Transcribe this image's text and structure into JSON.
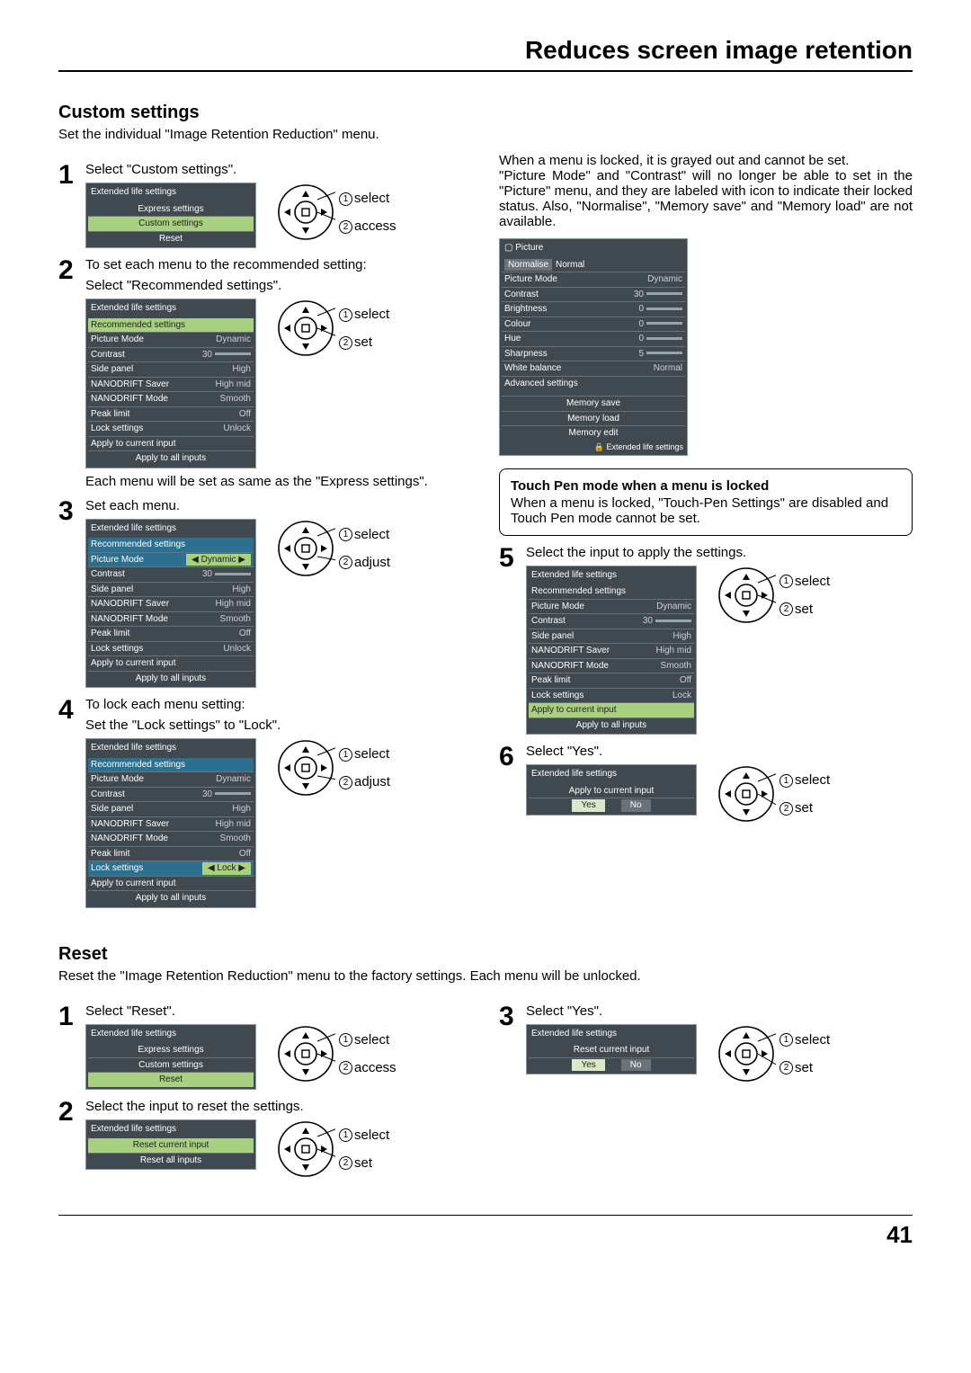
{
  "page_title": "Reduces screen image retention",
  "page_number": "41",
  "custom": {
    "heading": "Custom settings",
    "lead": "Set the individual \"Image Retention Reduction\" menu.",
    "steps": {
      "1": {
        "text": "Select \"Custom settings\"."
      },
      "2": {
        "text1": "To set each menu to the recommended setting:",
        "text2": "Select \"Recommended settings\".",
        "note": "Each menu will be set as same as the \"Express settings\"."
      },
      "3": {
        "text": "Set each menu."
      },
      "4": {
        "text1": "To lock each menu setting:",
        "text2": "Set the \"Lock settings\" to \"Lock\"."
      },
      "5": {
        "text": "Select the input to apply the settings."
      },
      "6": {
        "text": "Select \"Yes\"."
      }
    },
    "lock_note": "When a menu is locked, it is grayed out and cannot be set.\n\"Picture Mode\" and \"Contrast\" will no longer be able to set in the \"Picture\" menu, and they are labeled with icon to indicate their locked status. Also, \"Normalise\", \"Memory save\" and \"Memory load\" are not available.",
    "touchpen": {
      "title": "Touch Pen mode when a menu is locked",
      "body": "When a menu is locked, \"Touch-Pen Settings\" are disabled and Touch Pen mode cannot be set."
    }
  },
  "reset": {
    "heading": "Reset",
    "lead": "Reset the \"Image Retention Reduction\" menu to the factory settings. Each menu will be unlocked.",
    "steps": {
      "1": {
        "text": "Select \"Reset\"."
      },
      "2": {
        "text": "Select the input to reset the settings."
      },
      "3": {
        "text": "Select \"Yes\"."
      }
    }
  },
  "labels": {
    "select": "select",
    "access": "access",
    "set": "set",
    "adjust": "adjust"
  },
  "osd": {
    "ext_title": "Extended life settings",
    "express": "Express settings",
    "custom": "Custom settings",
    "reset": "Reset",
    "recommended": "Recommended settings",
    "picture_mode": "Picture Mode",
    "contrast": "Contrast",
    "side_panel": "Side panel",
    "nano_saver": "NANODRIFT Saver",
    "nano_mode": "NANODRIFT Mode",
    "peak_limit": "Peak limit",
    "lock_settings": "Lock settings",
    "apply_cur": "Apply to current input",
    "apply_all": "Apply to all inputs",
    "reset_cur": "Reset current input",
    "reset_all": "Reset all inputs",
    "yes": "Yes",
    "no": "No",
    "vals": {
      "dynamic": "Dynamic",
      "c30": "30",
      "high": "High",
      "high_mid": "High mid",
      "smooth": "Smooth",
      "off": "Off",
      "unlock": "Unlock",
      "lock": "Lock"
    }
  },
  "picture": {
    "title": "Picture",
    "normalise": "Normalise",
    "normal": "Normal",
    "brightness": "Brightness",
    "colour": "Colour",
    "hue": "Hue",
    "sharpness": "Sharpness",
    "white_balance": "White balance",
    "advanced": "Advanced settings",
    "mem_save": "Memory save",
    "mem_load": "Memory load",
    "mem_edit": "Memory edit",
    "footer": "Extended life settings",
    "vals": {
      "b0": "0",
      "b30": "30",
      "s5": "5"
    }
  }
}
